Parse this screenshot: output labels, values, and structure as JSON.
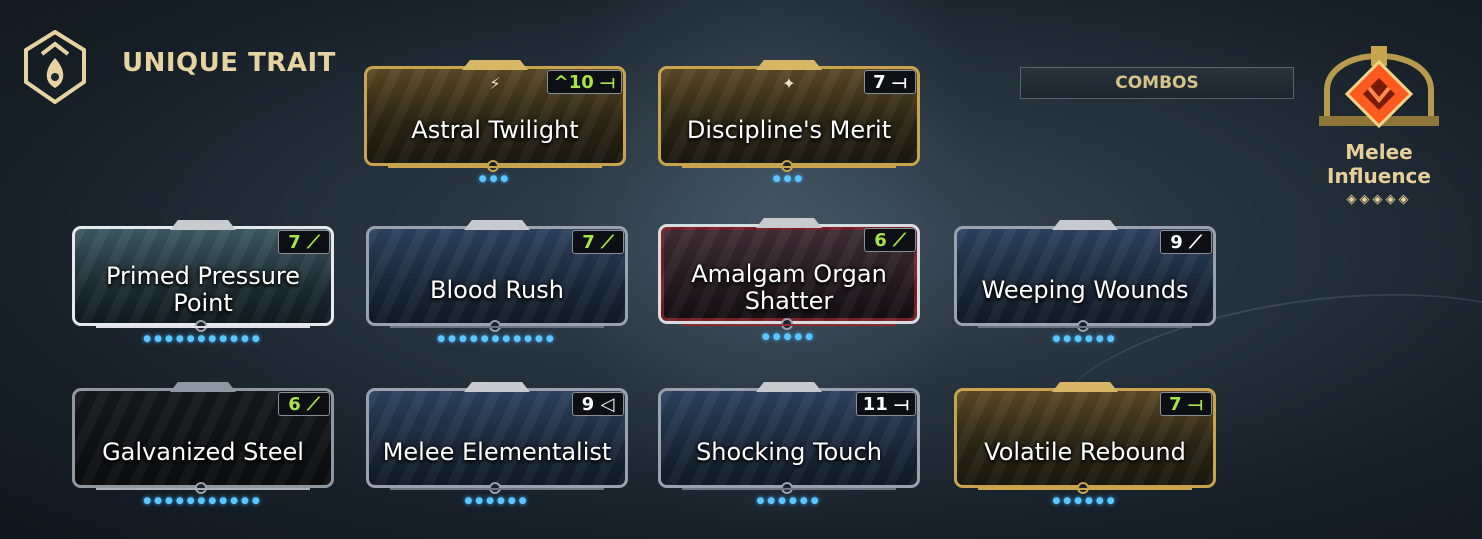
{
  "header": {
    "trait_title": "UNIQUE TRAIT"
  },
  "combos": {
    "label": "COMBOS"
  },
  "influence": {
    "label": "Melee Influence",
    "ranks_text": "◈◈◈◈◈",
    "accent": "#ff5a1f"
  },
  "cards": [
    {
      "name": "Astral Twilight",
      "drain": "^10",
      "polarity": "naramon-icon",
      "rarity": "gold"
    },
    {
      "name": "Discipline's Merit",
      "drain": "7",
      "polarity": "naramon-icon",
      "rarity": "gold"
    },
    {
      "name": "Primed Pressure Point",
      "drain": "7",
      "polarity": "madurai-icon",
      "rarity": "silver"
    },
    {
      "name": "Blood Rush",
      "drain": "7",
      "polarity": "madurai-icon",
      "rarity": "bronze"
    },
    {
      "name": "Amalgam Organ Shatter",
      "drain": "6",
      "polarity": "madurai-icon",
      "rarity": "amalgam"
    },
    {
      "name": "Weeping Wounds",
      "drain": "9",
      "polarity": "madurai-icon",
      "rarity": "bronze"
    },
    {
      "name": "Galvanized Steel",
      "drain": "6",
      "polarity": "madurai-icon",
      "rarity": "galvanized"
    },
    {
      "name": "Melee Elementalist",
      "drain": "9",
      "polarity": "vazarin-icon",
      "rarity": "bronze"
    },
    {
      "name": "Shocking Touch",
      "drain": "11",
      "polarity": "naramon-icon",
      "rarity": "bronze"
    },
    {
      "name": "Volatile Rebound",
      "drain": "7",
      "polarity": "naramon-icon",
      "rarity": "gold"
    }
  ],
  "colors": {
    "drain_matched": "#a7e34a",
    "drain_default": "#ffffff",
    "title_gold": "#e7d3a1"
  }
}
